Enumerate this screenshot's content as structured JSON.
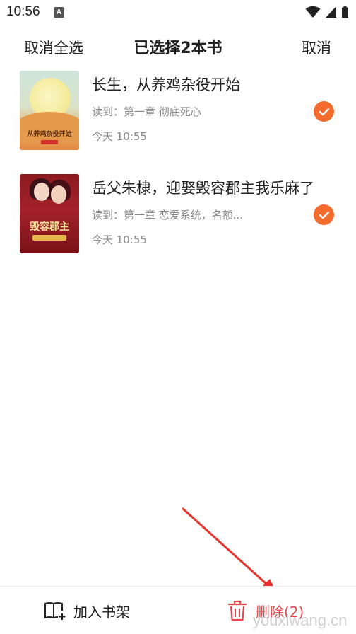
{
  "status_bar": {
    "time": "10:56",
    "notification_letter": "A"
  },
  "header": {
    "select_all_cancel": "取消全选",
    "title": "已选择2本书",
    "cancel": "取消"
  },
  "books": [
    {
      "title": "长生，从养鸡杂役开始",
      "progress": "读到：第一章 彻底死心",
      "time": "今天 10:55",
      "cover_text": "从养鸡杂役开始",
      "selected": true
    },
    {
      "title": "岳父朱棣，迎娶毁容郡主我乐麻了",
      "progress": "读到：第一章 恋爱系统，名额...",
      "time": "今天 10:55",
      "cover_text": "毁容郡主",
      "selected": true
    }
  ],
  "bottom_bar": {
    "add_to_shelf": "加入书架",
    "delete": "删除(2)"
  },
  "watermark": "youxiwang.cn",
  "colors": {
    "accent": "#f46b2e",
    "delete": "#e8474c",
    "arrow": "#e8342c"
  }
}
